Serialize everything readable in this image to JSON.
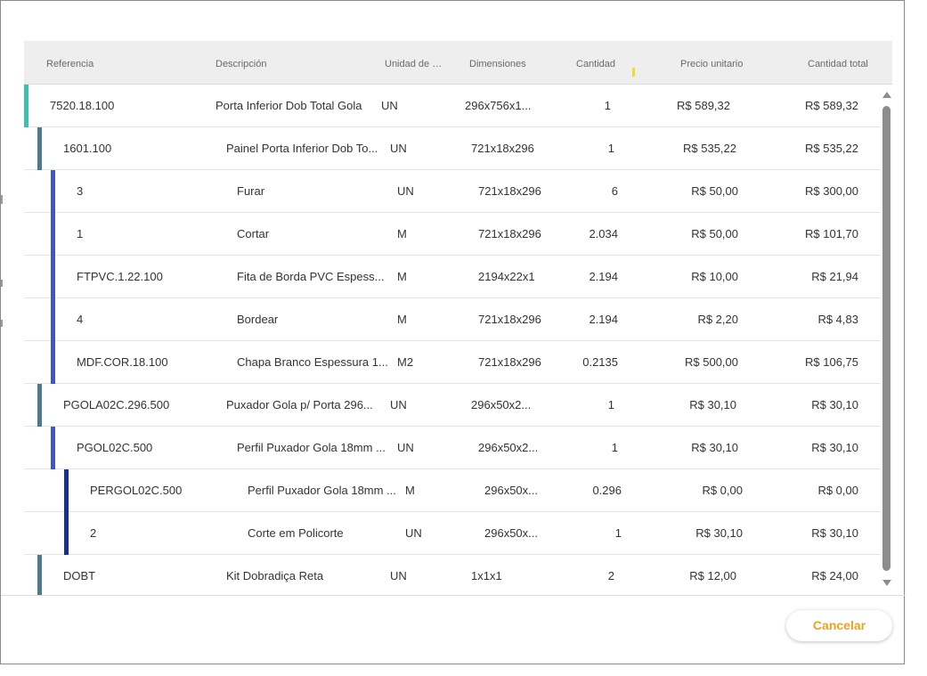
{
  "table": {
    "headers": [
      "Referencia",
      "Descripción",
      "Unidad de medida",
      "Dimensiones",
      "Cantidad",
      "Precio unitario",
      "Cantidad total"
    ],
    "rows": [
      {
        "level": 0,
        "bar_color": "#3dbfae",
        "ref": "7520.18.100",
        "desc": "Porta Inferior Dob Total Gola",
        "unit": "UN",
        "dim": "296x756x1...",
        "qty": "1",
        "price": "R$ 589,32",
        "total": "R$ 589,32"
      },
      {
        "level": 1,
        "bar_color": "#4e7a8c",
        "ref": "1601.100",
        "desc": "Painel Porta Inferior Dob To...",
        "unit": "UN",
        "dim": "721x18x296",
        "qty": "1",
        "price": "R$ 535,22",
        "total": "R$ 535,22"
      },
      {
        "level": 2,
        "bar_color": "#3f55c8",
        "ref": "3",
        "desc": "Furar",
        "unit": "UN",
        "dim": "721x18x296",
        "qty": "6",
        "price": "R$ 50,00",
        "total": "R$ 300,00"
      },
      {
        "level": 2,
        "bar_color": "#3f55c8",
        "ref": "1",
        "desc": "Cortar",
        "unit": "M",
        "dim": "721x18x296",
        "qty": "2.034",
        "price": "R$ 50,00",
        "total": "R$ 101,70"
      },
      {
        "level": 2,
        "bar_color": "#3f55c8",
        "ref": "FTPVC.1.22.100",
        "desc": "Fita de Borda PVC Espess...",
        "unit": "M",
        "dim": "2194x22x1",
        "qty": "2.194",
        "price": "R$ 10,00",
        "total": "R$ 21,94"
      },
      {
        "level": 2,
        "bar_color": "#3f55c8",
        "ref": "4",
        "desc": "Bordear",
        "unit": "M",
        "dim": "721x18x296",
        "qty": "2.194",
        "price": "R$ 2,20",
        "total": "R$ 4,83"
      },
      {
        "level": 2,
        "bar_color": "#3f55c8",
        "ref": "MDF.COR.18.100",
        "desc": "Chapa Branco Espessura 1...",
        "unit": "M2",
        "dim": "721x18x296",
        "qty": "0.2135",
        "price": "R$ 500,00",
        "total": "R$ 106,75"
      },
      {
        "level": 1,
        "bar_color": "#4e7a8c",
        "ref": "PGOLA02C.296.500",
        "desc": "Puxador Gola p/ Porta 296...",
        "unit": "UN",
        "dim": "296x50x2...",
        "qty": "1",
        "price": "R$ 30,10",
        "total": "R$ 30,10"
      },
      {
        "level": 2,
        "bar_color": "#3f55c8",
        "ref": "PGOL02C.500",
        "desc": "Perfil Puxador Gola 18mm ...",
        "unit": "UN",
        "dim": "296x50x2...",
        "qty": "1",
        "price": "R$ 30,10",
        "total": "R$ 30,10"
      },
      {
        "level": 3,
        "bar_color": "#1a2f8a",
        "ref": "PERGOL02C.500",
        "desc": "Perfil Puxador Gola 18mm ...",
        "unit": "M",
        "dim": "296x50x...",
        "qty": "0.296",
        "price": "R$ 0,00",
        "total": "R$ 0,00"
      },
      {
        "level": 3,
        "bar_color": "#1a2f8a",
        "ref": "2",
        "desc": "Corte em Policorte",
        "unit": "UN",
        "dim": "296x50x...",
        "qty": "1",
        "price": "R$ 30,10",
        "total": "R$ 30,10"
      },
      {
        "level": 1,
        "bar_color": "#4e7a8c",
        "ref": "DOBT",
        "desc": "Kit Dobradiça Reta",
        "unit": "UN",
        "dim": "1x1x1",
        "qty": "2",
        "price": "R$ 12,00",
        "total": "R$ 24,00"
      }
    ]
  },
  "footer": {
    "cancel_label": "Cancelar"
  },
  "colors": {
    "accent": "#f0a020",
    "header_bg": "#eeeeee"
  }
}
